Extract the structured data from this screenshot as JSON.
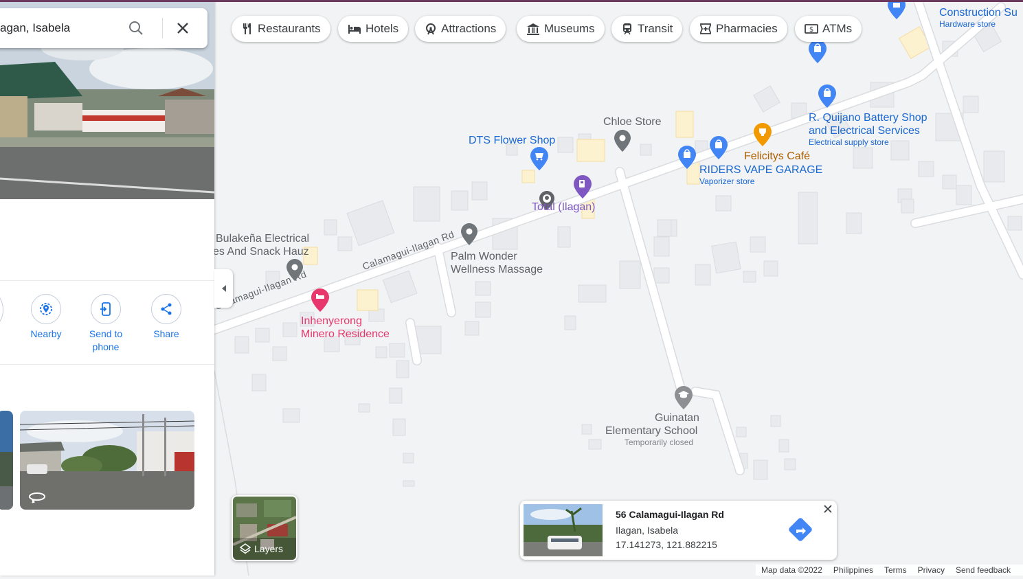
{
  "search": {
    "query": "agan, Isabela"
  },
  "actions": [
    {
      "label": "Nearby"
    },
    {
      "label": "Send to\nphone"
    },
    {
      "label": "Share"
    }
  ],
  "chips": [
    {
      "label": "Restaurants",
      "icon": "fork-knife-icon"
    },
    {
      "label": "Hotels",
      "icon": "bed-icon"
    },
    {
      "label": "Attractions",
      "icon": "ferris-wheel-icon"
    },
    {
      "label": "Museums",
      "icon": "museum-icon"
    },
    {
      "label": "Transit",
      "icon": "train-icon"
    },
    {
      "label": "Pharmacies",
      "icon": "pharmacy-icon"
    },
    {
      "label": "ATMs",
      "icon": "atm-icon"
    }
  ],
  "map": {
    "roads": {
      "main1": "Calamagui-Ilagan Rd",
      "main2": "Calamagui-Ilagan Rd"
    },
    "places": {
      "bulakena": "Bulakeña Electrical",
      "snack": "es And Snack Hauz",
      "dts": "DTS Flower Shop",
      "chloe": "Chloe Store",
      "total": "Total (Ilagan)",
      "palm1": "Palm Wonder",
      "palm2": "Wellness Massage",
      "inhen1": "Inhenyerong",
      "inhen2": "Minero Residence",
      "felicitys": "Felicitys Café",
      "riders": "RIDERS VAPE GARAGE",
      "riders_sub": "Vaporizer store",
      "quijano1": "R. Quijano Battery Shop",
      "quijano2": "and Electrical Services",
      "quijano_sub": "Electrical supply store",
      "construction": "Construction Su",
      "construction_sub": "Hardware store",
      "school1": "Guinatan",
      "school2": "Elementary School",
      "school_sub": "Temporarily closed"
    }
  },
  "layers": {
    "label": "Layers"
  },
  "card": {
    "title": "56 Calamagui-Ilagan Rd",
    "locality": "Ilagan, Isabela",
    "coords": "17.141273, 121.882215"
  },
  "footer": {
    "mapdata": "Map data ©2022",
    "country": "Philippines",
    "terms": "Terms",
    "privacy": "Privacy",
    "feedback": "Send feedback"
  },
  "colors": {
    "accent": "#1a73e8",
    "poi_gray": "#70757a",
    "poi_pink": "#e8376c",
    "poi_orange": "#f29900",
    "poi_blue": "#4285f4",
    "poi_purple": "#7e57c2",
    "brown_label": "#b06000"
  }
}
